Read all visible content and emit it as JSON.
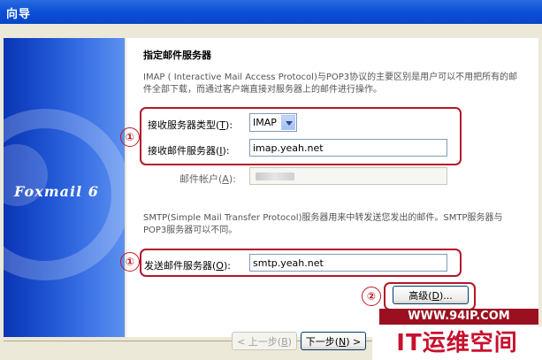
{
  "window": {
    "title": "向导"
  },
  "banner": {
    "logo": "Foxmail 6"
  },
  "section": {
    "heading": "指定邮件服务器",
    "imap_desc": "IMAP ( Interactive Mail Access Protocol)与POP3协议的主要区别是用户可以不用把所有的邮件全部下载，而通过客户端直接对服务器上的邮件进行操作。",
    "smtp_desc": "SMTP(Simple Mail Transfer Protocol)服务器用来中转发送您发出的邮件。SMTP服务器与POP3服务器可以不同。"
  },
  "fields": {
    "server_type": {
      "label_prefix": "接收服务器类型(",
      "hotkey": "T",
      "label_suffix": "):",
      "value": "IMAP"
    },
    "incoming_server": {
      "label_prefix": "接收邮件服务器(",
      "hotkey": "I",
      "label_suffix": "):",
      "value": "imap.yeah.net"
    },
    "account": {
      "label_prefix": "邮件帐户(",
      "hotkey": "A",
      "label_suffix": "):"
    },
    "outgoing_server": {
      "label_prefix": "发送邮件服务器(",
      "hotkey": "O",
      "label_suffix": "):",
      "value": "smtp.yeah.net"
    }
  },
  "buttons": {
    "advanced": {
      "prefix": "高级(",
      "hotkey": "D",
      "suffix": ")..."
    },
    "back": {
      "prefix": "< 上一步(",
      "hotkey": "B",
      "suffix": ")"
    },
    "next": {
      "prefix": "下一步(",
      "hotkey": "N",
      "suffix": ") >"
    }
  },
  "annotations": {
    "mark1": "①",
    "mark2": "②"
  },
  "watermark": {
    "url": "WWW.94IP.COM",
    "brand": "IT运维空间"
  },
  "colors": {
    "accent_red": "#b2172b",
    "titlebar_blue": "#0b4fd6"
  }
}
